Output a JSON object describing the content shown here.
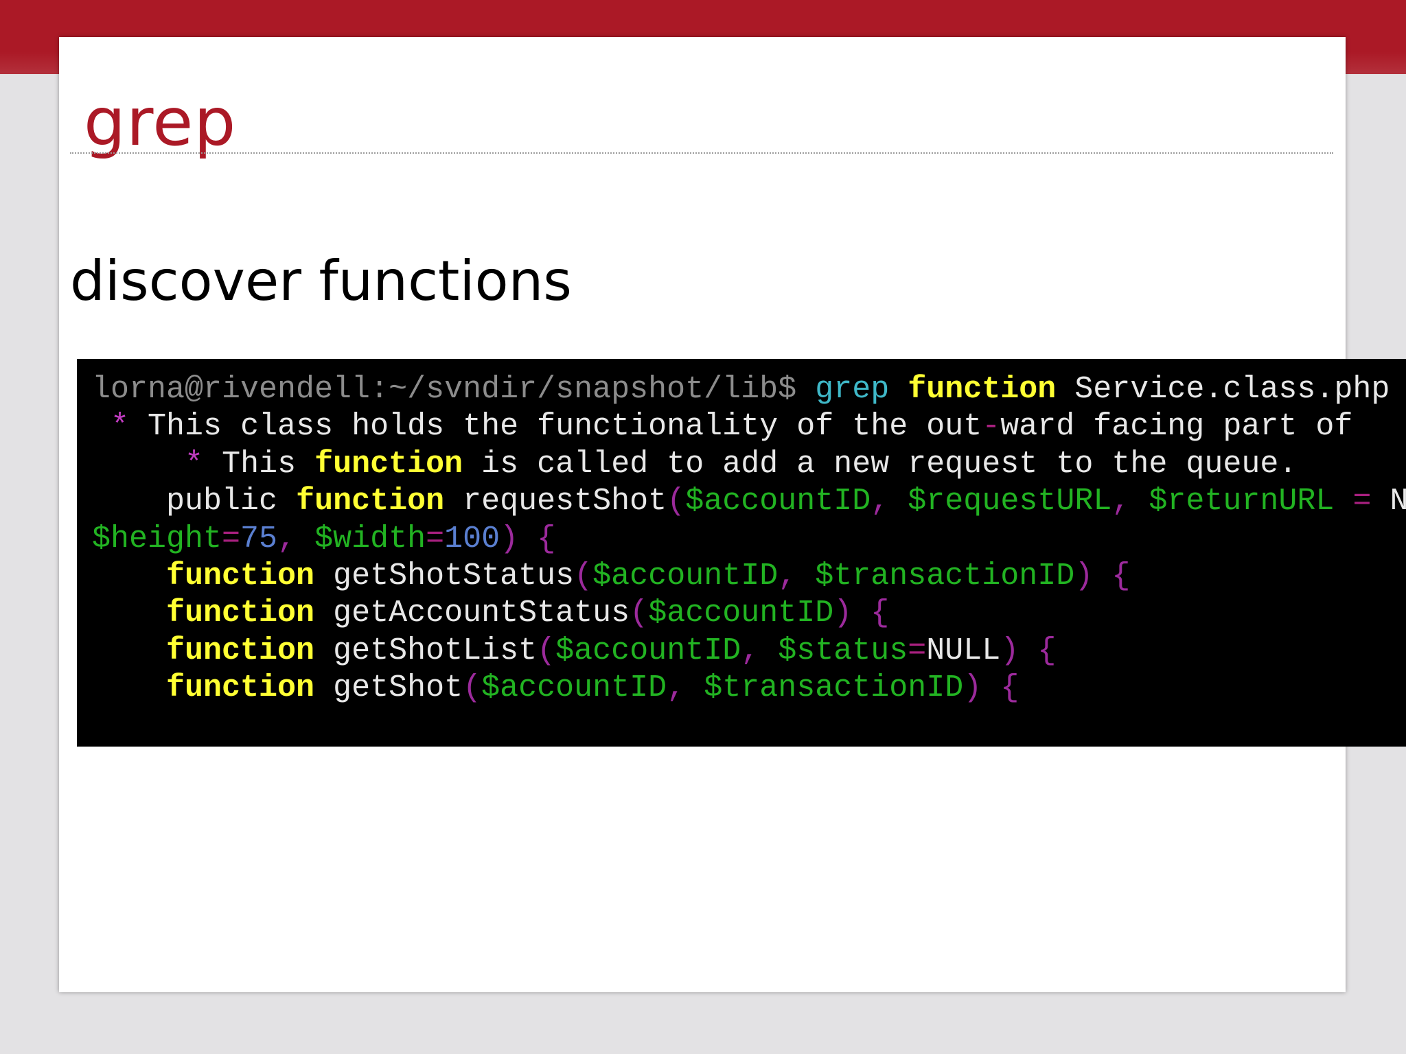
{
  "slide": {
    "title": "grep",
    "subtitle": "discover functions"
  },
  "terminal": {
    "line1": {
      "prompt": "lorna@rivendell:~/svndir/snapshot/lib$",
      "command": "grep",
      "keyword": "function",
      "argument": "Service.class.php"
    },
    "line2": {
      "star": "*",
      "text_a": "This class holds the functionality of the out",
      "dash": "-",
      "text_b": "ward facing part of"
    },
    "line3": {
      "star": "*",
      "text_a": "This",
      "keyword": "function",
      "text_b": "is called to add a new request to the queue."
    },
    "line4": {
      "text_a": "public",
      "keyword": "function",
      "name": "requestShot",
      "open_paren": "(",
      "var1": "$accountID",
      "comma1": ",",
      "var2": "$requestURL",
      "comma2": ",",
      "var3": "$returnURL",
      "equals": "=",
      "tail": "N"
    },
    "line5": {
      "var1": "$height",
      "eq1": "=",
      "num1": "75",
      "comma": ",",
      "var2": "$width",
      "eq2": "=",
      "num2": "100",
      "close": ")",
      "brace": "{"
    },
    "line6": {
      "keyword": "function",
      "name": "getShotStatus",
      "open_paren": "(",
      "var1": "$accountID",
      "comma": ",",
      "var2": "$transactionID",
      "close": ")",
      "brace": "{"
    },
    "line7": {
      "keyword": "function",
      "name": "getAccountStatus",
      "open_paren": "(",
      "var1": "$accountID",
      "close": ")",
      "brace": "{"
    },
    "line8": {
      "keyword": "function",
      "name": "getShotList",
      "open_paren": "(",
      "var1": "$accountID",
      "comma": ",",
      "var2": "$status",
      "eq": "=",
      "value": "NULL",
      "close": ")",
      "brace": "{"
    },
    "line9": {
      "keyword": "function",
      "name": "getShot",
      "open_paren": "(",
      "var1": "$accountID",
      "comma": ",",
      "var2": "$transactionID",
      "close": ")",
      "brace": "{"
    }
  }
}
